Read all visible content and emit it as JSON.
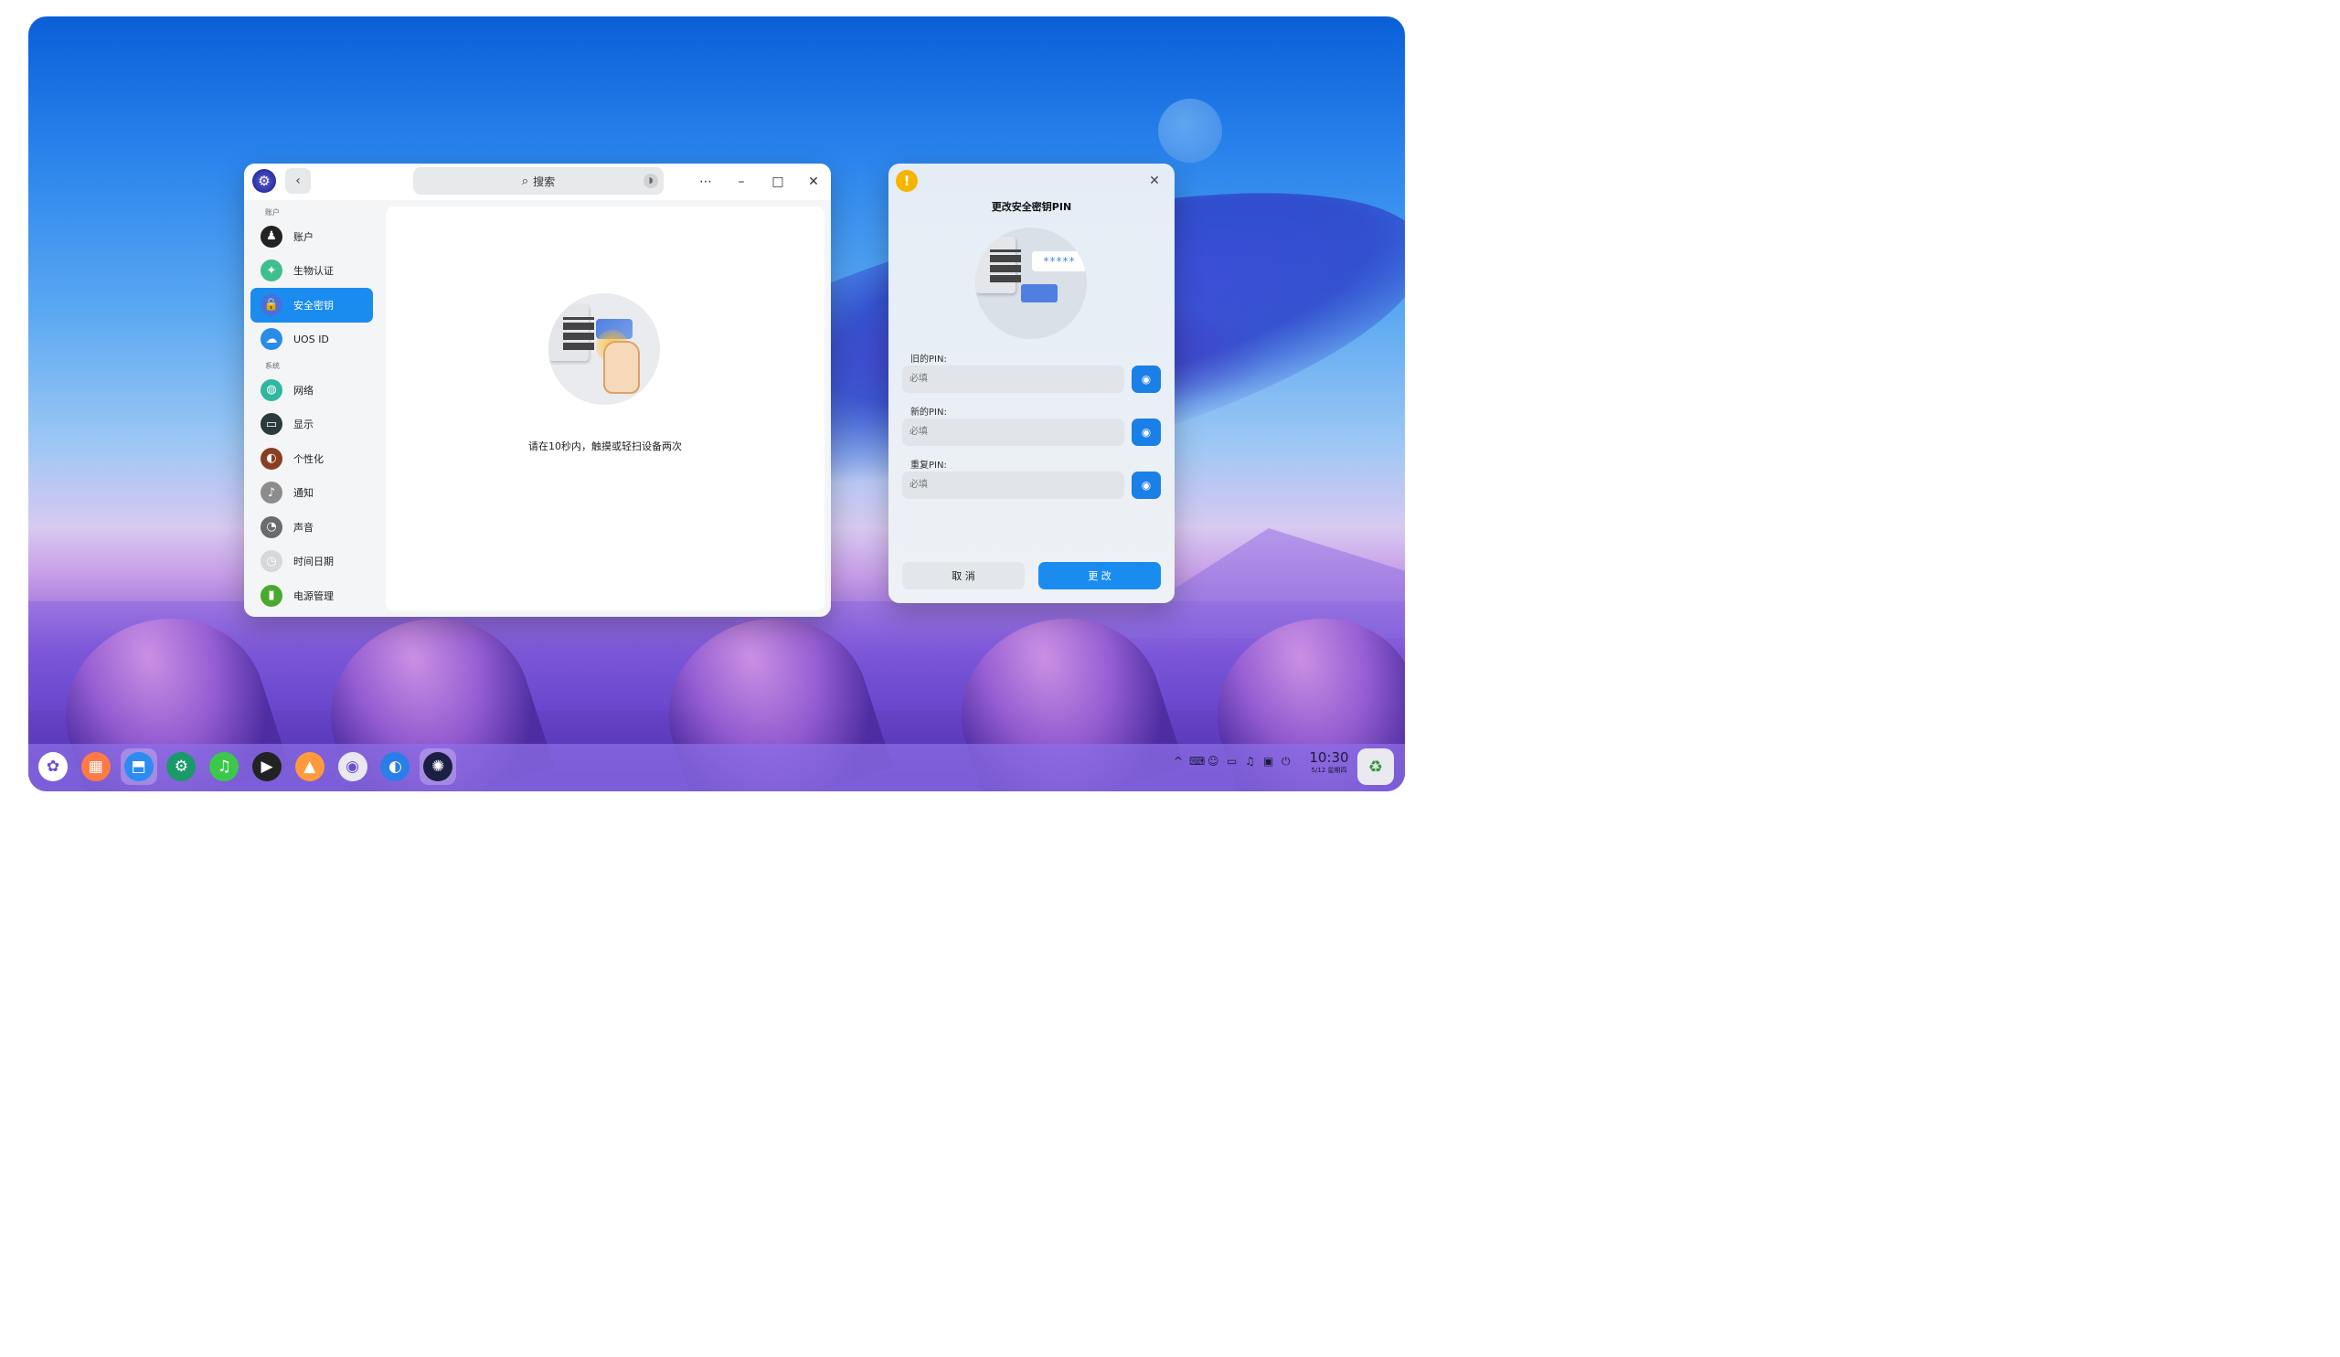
{
  "settings": {
    "search_placeholder": "搜索",
    "groups": [
      {
        "label": "账户",
        "items": [
          {
            "label": "账户",
            "icon": "user-icon",
            "color": "#222222",
            "active": false
          },
          {
            "label": "生物认证",
            "icon": "fingerprint-icon",
            "color": "#3fbf8f",
            "active": false
          },
          {
            "label": "安全密钥",
            "icon": "security-key-icon",
            "color": "#4a6fd8",
            "active": true
          },
          {
            "label": "UOS ID",
            "icon": "cloud-icon",
            "color": "#2a8be8",
            "active": false
          }
        ]
      },
      {
        "label": "系统",
        "items": [
          {
            "label": "网络",
            "icon": "globe-icon",
            "color": "#2fb7a0",
            "active": false
          },
          {
            "label": "显示",
            "icon": "monitor-icon",
            "color": "#2b3a3a",
            "active": false
          },
          {
            "label": "个性化",
            "icon": "palette-icon",
            "color": "#8a3f22",
            "active": false
          },
          {
            "label": "通知",
            "icon": "bell-icon",
            "color": "#8c8c8c",
            "active": false
          },
          {
            "label": "声音",
            "icon": "speaker-icon",
            "color": "#6b6b6b",
            "active": false
          },
          {
            "label": "时间日期",
            "icon": "clock-icon",
            "color": "#d8d8d8",
            "active": false
          },
          {
            "label": "电源管理",
            "icon": "battery-icon",
            "color": "#49a82e",
            "active": false
          }
        ]
      }
    ],
    "hint": "请在10秒内，触摸或轻扫设备两次"
  },
  "dialog": {
    "title": "更改安全密钥PIN",
    "password_mask": "*****",
    "fields": [
      {
        "label": "旧的PIN:",
        "placeholder": "必填"
      },
      {
        "label": "新的PIN:",
        "placeholder": "必填"
      },
      {
        "label": "重复PIN:",
        "placeholder": "必填"
      }
    ],
    "cancel_label": "取 消",
    "confirm_label": "更 改"
  },
  "dock": {
    "apps": [
      {
        "icon": "launcher-icon",
        "color": "#ffffff",
        "active": false
      },
      {
        "icon": "multitask-icon",
        "color": "#ff7a45",
        "active": false
      },
      {
        "icon": "app-store-icon",
        "color": "#2d8cf0",
        "active": true
      },
      {
        "icon": "control-center-icon",
        "color": "#1a9a6a",
        "active": false
      },
      {
        "icon": "music-icon",
        "color": "#3cc84a",
        "active": false
      },
      {
        "icon": "video-player-icon",
        "color": "#222222",
        "active": false
      },
      {
        "icon": "album-icon",
        "color": "#ff9a3c",
        "active": false
      },
      {
        "icon": "camera-icon",
        "color": "#e8e8ee",
        "active": false
      },
      {
        "icon": "browser-icon",
        "color": "#2a7ee8",
        "active": false
      },
      {
        "icon": "settings-icon",
        "color": "#1c1f44",
        "active": true
      }
    ],
    "tray_icons": [
      "chevron-up-icon",
      "keyboard-icon",
      "user-tray-icon",
      "drive-icon",
      "notification-icon",
      "battery-tray-icon",
      "power-icon"
    ],
    "clock_time": "10:30",
    "clock_date": "5/12 星期四",
    "trash_icon": "trash-icon"
  },
  "colors": {
    "accent": "#1a8cf0",
    "warning": "#f5b400"
  }
}
